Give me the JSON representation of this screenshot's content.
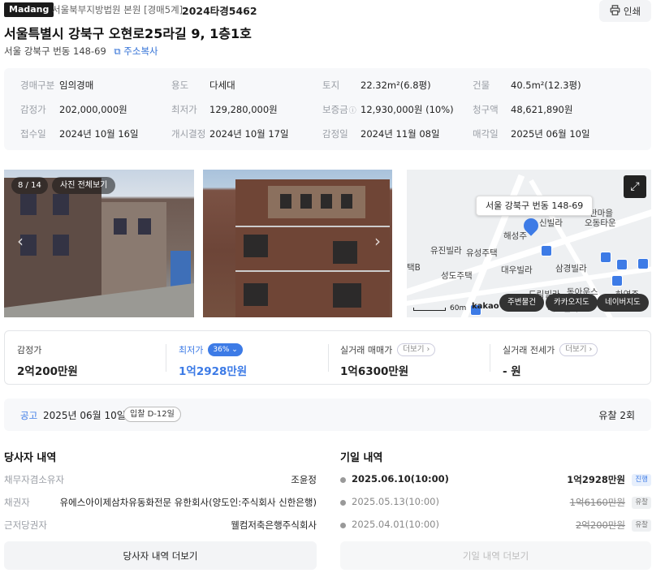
{
  "header": {
    "brand": "Madang",
    "court": "서울북부지방법원 본원 [경매5계]",
    "case_no": "2024타경5462",
    "print_label": "인쇄",
    "title": "서울특별시 강북구 오현로25라길 9, 1층1호",
    "sub_address": "서울 강북구 번동 148-69",
    "copy_label": "주소복사"
  },
  "info": [
    {
      "label": "경매구분",
      "value": "임의경매"
    },
    {
      "label": "용도",
      "value": "다세대"
    },
    {
      "label": "토지",
      "value": "22.32m²(6.8평)"
    },
    {
      "label": "건물",
      "value": "40.5m²(12.3평)"
    },
    {
      "label": "감정가",
      "value": "202,000,000원"
    },
    {
      "label": "최저가",
      "value": "129,280,000원"
    },
    {
      "label": "보증금",
      "value": "12,930,000원 (10%)"
    },
    {
      "label": "청구액",
      "value": "48,621,890원"
    },
    {
      "label": "접수일",
      "value": "2024년 10월 16일"
    },
    {
      "label": "개시결정",
      "value": "2024년 10월 17일"
    },
    {
      "label": "감정일",
      "value": "2024년 11월 08일"
    },
    {
      "label": "매각일",
      "value": "2025년 06월 10일"
    }
  ],
  "photos": {
    "counter": "8 / 14",
    "view_all": "사진 전체보기"
  },
  "map": {
    "address_popup": "서울 강북구 번동 148-69",
    "pois": [
      "한마을",
      "오동타운",
      "신빌라",
      "해성주",
      "유진빌라",
      "유성주택",
      "대우빌라",
      "삼경빌라",
      "성도주택",
      "드림빌라",
      "동아운스",
      "태진빌라",
      "하연주",
      "택B"
    ],
    "scale": "60m",
    "kakao": "kakao",
    "btn_nearby": "주변물건",
    "btn_kakao": "카카오지도",
    "btn_naver": "네이버지도"
  },
  "prices": {
    "appraisal_label": "감정가",
    "appraisal_value": "2억200만원",
    "min_label": "최저가",
    "min_pct": "36%",
    "min_value": "1억2928만원",
    "sale_label": "실거래 매매가",
    "sale_more": "더보기",
    "sale_value": "1억6300만원",
    "rent_label": "실거래 전세가",
    "rent_more": "더보기",
    "rent_value": "- 원"
  },
  "notice": {
    "label": "공고",
    "date": "2025년 06월 10일",
    "dday": "입찰 D-12일",
    "fail_count": "유찰 2회"
  },
  "parties": {
    "title": "당사자 내역",
    "rows": [
      {
        "label": "채무자겸소유자",
        "value": "조윤정"
      },
      {
        "label": "채권자",
        "value": "유에스아이제삼차유동화전문 유한회사(양도인:주식회사 신한은행)"
      },
      {
        "label": "근저당권자",
        "value": "웰컴저축은행주식회사"
      }
    ],
    "more_button": "당사자 내역 더보기"
  },
  "history": {
    "title": "기일 내역",
    "rows": [
      {
        "date": "2025.06.10(10:00)",
        "price": "1억2928만원",
        "status": "진행"
      },
      {
        "date": "2025.05.13(10:00)",
        "price": "1억6160만원",
        "status": "유찰"
      },
      {
        "date": "2025.04.01(10:00)",
        "price": "2억200만원",
        "status": "유찰"
      }
    ],
    "more_button": "기일 내역 더보기"
  }
}
